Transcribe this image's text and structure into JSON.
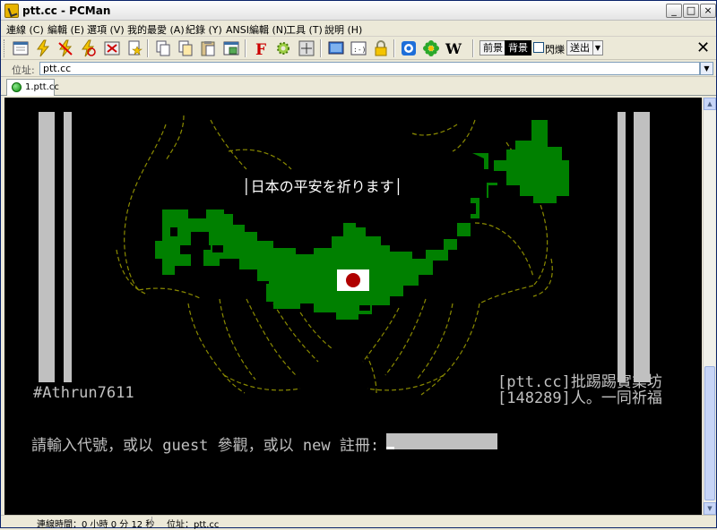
{
  "window": {
    "title": "ptt.cc - PCMan"
  },
  "menu": [
    "連線 (C)",
    "編輯 (E)",
    "選項 (V)",
    "我的最愛 (A)",
    "紀錄 (Y)",
    "ANSI編輯 (N)",
    "工具 (T)",
    "說明 (H)"
  ],
  "toolbar": {
    "prev_label": "前景",
    "bg_label": "背景",
    "blink_label": "閃爍",
    "send_label": "送出",
    "w_label": "W",
    "f_label": "F"
  },
  "address": {
    "label": "位址:",
    "value": "ptt.cc"
  },
  "tab": {
    "label": "1.ptt.cc"
  },
  "terminal": {
    "banner": "日本の平安を祈ります",
    "signature": "#Athrun7611",
    "site": "[ptt.cc]批踢踢實業坊",
    "online": "[148289]人。一同祈福",
    "prompt": "請輸入代號，或以 guest 參觀，或以 new 註冊: "
  },
  "status": {
    "time": "連線時間：0 小時 0 分 12 秒",
    "addr": "位址：ptt.cc"
  },
  "colors": {
    "map_green": "#008000",
    "hands_yellow": "#8a8a00",
    "terminal_bg": "#000000",
    "terminal_gray": "#c0c0c0",
    "flag_red": "#b00000"
  }
}
